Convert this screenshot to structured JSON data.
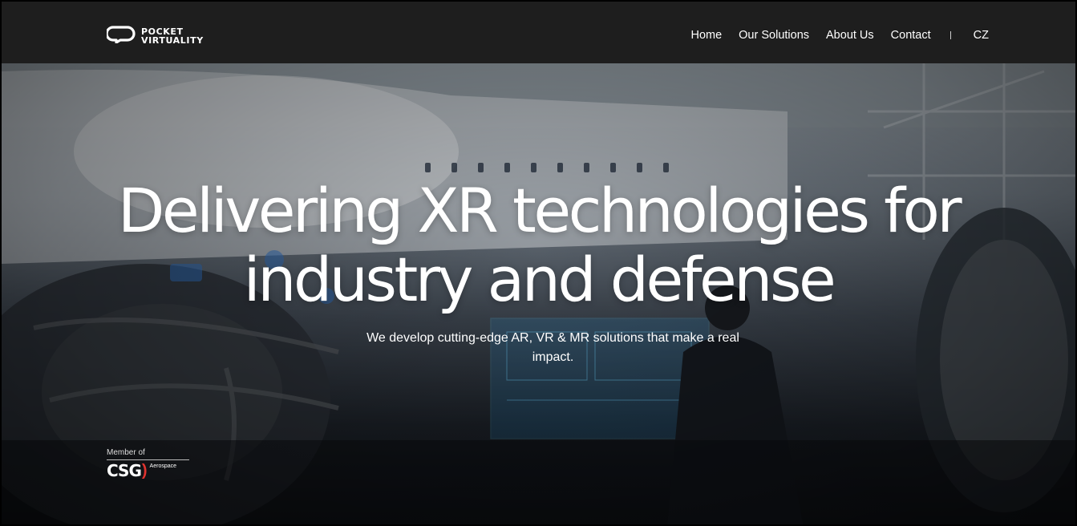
{
  "brand": {
    "name_line1": "POCKET",
    "name_line2": "VIRTUALITY"
  },
  "nav": {
    "items": [
      {
        "label": "Home"
      },
      {
        "label": "Our Solutions"
      },
      {
        "label": "About Us"
      },
      {
        "label": "Contact"
      }
    ],
    "lang_label": "CZ"
  },
  "hero": {
    "title_line1": "Delivering XR technologies for",
    "title_line2": "industry and defense",
    "subtitle": "We develop cutting-edge AR, VR & MR solutions that make a real impact."
  },
  "member": {
    "label": "Member of",
    "logo_word": "CSG",
    "logo_paren": ")",
    "logo_suffix": "Aerospace"
  },
  "colors": {
    "nav_bg": "#1e1e1e",
    "accent_red": "#e0332f",
    "text": "#ffffff"
  }
}
